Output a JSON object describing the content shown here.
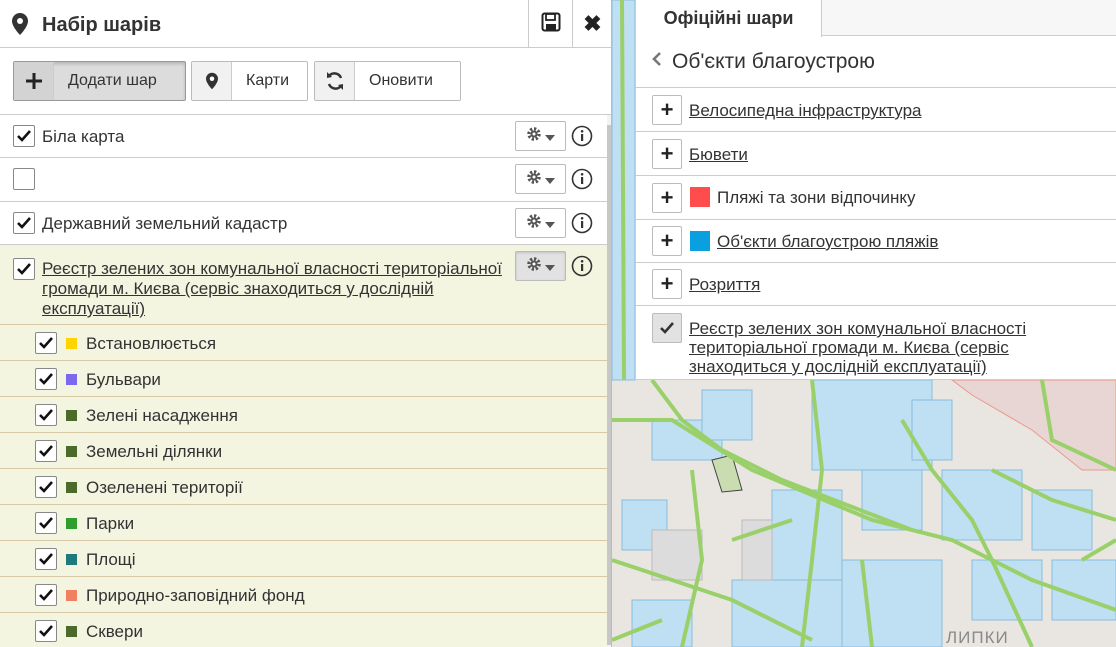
{
  "left_panel": {
    "title": "Набір шарів",
    "toolbar": {
      "add_label": "Додати шар",
      "maps_label": "Карти",
      "refresh_label": "Оновити"
    },
    "layers": [
      {
        "label": "Біла карта",
        "checked": true
      },
      {
        "label": "",
        "checked": false
      },
      {
        "label": "Державний земельний кадастр",
        "checked": true
      },
      {
        "label": "Реєстр зелених зон комунальної власності територіальної громади м. Києва (сервіс знаходиться у дослідній експлуатації)",
        "checked": true
      }
    ],
    "sublayers": [
      {
        "label": "Встановлюється",
        "color": "#ffd400"
      },
      {
        "label": "Бульвари",
        "color": "#7b68ee"
      },
      {
        "label": "Зелені насадження",
        "color": "#4a6b2a"
      },
      {
        "label": "Земельні ділянки",
        "color": "#4a6b2a"
      },
      {
        "label": "Озеленені території",
        "color": "#4a6b2a"
      },
      {
        "label": "Парки",
        "color": "#2e9e2e"
      },
      {
        "label": "Площі",
        "color": "#1e7b7b"
      },
      {
        "label": "Природно-заповідний фонд",
        "color": "#f08060"
      },
      {
        "label": "Сквери",
        "color": "#4a6b2a"
      }
    ]
  },
  "right_panel": {
    "tab": "Офіційні шари",
    "header": "Об'єкти благоустрою",
    "items": [
      {
        "label": "Велосипедна інфраструктура",
        "added": false,
        "linked": true,
        "swatch": ""
      },
      {
        "label": "Бювети",
        "added": false,
        "linked": true,
        "swatch": ""
      },
      {
        "label": "Пляжі та зони відпочинку",
        "added": false,
        "linked": false,
        "swatch": "#ff4d4d"
      },
      {
        "label": "Об'єкти благоустрою пляжів",
        "added": false,
        "linked": true,
        "swatch": "#0aa0e0"
      },
      {
        "label": "Розриття",
        "added": false,
        "linked": true,
        "swatch": ""
      },
      {
        "label": "Реєстр зелених зон комунальної власності територіальної громади м. Києва (сервіс знаходиться у дослідній експлуатації)",
        "added": true,
        "linked": true,
        "swatch": ""
      }
    ]
  },
  "map": {
    "label": "ЛИПКИ"
  }
}
